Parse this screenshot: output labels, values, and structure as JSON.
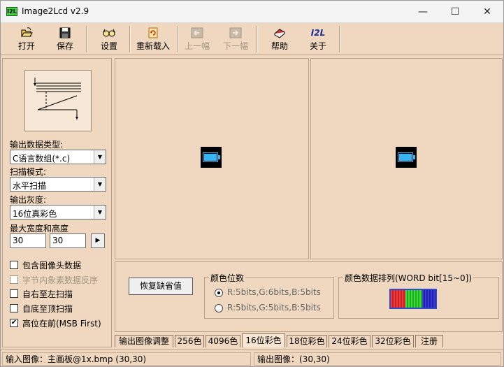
{
  "window": {
    "title": "Image2Lcd v2.9",
    "icon_text": "I2L",
    "min_glyph": "—",
    "max_glyph": "☐",
    "close_glyph": "✕"
  },
  "toolbar": {
    "items": [
      {
        "label": "打开",
        "icon": "folder-open-icon",
        "enabled": true
      },
      {
        "label": "保存",
        "icon": "floppy-disk-icon",
        "enabled": true
      },
      {
        "label": "设置",
        "icon": "glasses-icon",
        "enabled": true
      },
      {
        "label": "重新载入",
        "icon": "reload-icon",
        "enabled": true
      },
      {
        "label": "上一幅",
        "icon": "arrow-left-icon",
        "enabled": false
      },
      {
        "label": "下一幅",
        "icon": "arrow-right-icon",
        "enabled": false
      },
      {
        "label": "帮助",
        "icon": "help-book-icon",
        "enabled": true
      },
      {
        "label": "关于",
        "icon": "i2l-logo-icon",
        "enabled": true
      }
    ],
    "about_icon_text": "I2L"
  },
  "left": {
    "output_type_label": "输出数据类型:",
    "output_type_value": "C语言数组(*.c)",
    "scan_mode_label": "扫描模式:",
    "scan_mode_value": "水平扫描",
    "gray_label": "输出灰度:",
    "gray_value": "16位真彩色",
    "max_size_label": "最大宽度和高度",
    "max_width": "30",
    "max_height": "30",
    "apply_glyph": "▶",
    "dropdown_glyph": "▼",
    "checkboxes": [
      {
        "label": "包含图像头数据",
        "checked": false,
        "enabled": true
      },
      {
        "label": "字节内象素数据反序",
        "checked": false,
        "enabled": false
      },
      {
        "label": "自右至左扫描",
        "checked": false,
        "enabled": true
      },
      {
        "label": "自底至顶扫描",
        "checked": false,
        "enabled": true
      },
      {
        "label": "高位在前(MSB First)",
        "checked": true,
        "enabled": true
      }
    ],
    "check_glyph": "✔"
  },
  "settings": {
    "restore_label": "恢复缺省值",
    "color_bits_title": "颜色位数",
    "options": [
      {
        "label": "R:5bits,G:6bits,B:5bits",
        "selected": true
      },
      {
        "label": "R:5bits,G:5bits,B:5bits",
        "selected": false
      }
    ],
    "order_title": "颜色数据排列(WORD bit[15~0])",
    "bit_colors": {
      "red": "#ef3b3b",
      "green": "#3cdc3c",
      "blue": "#3c3cdc"
    }
  },
  "tabs": [
    {
      "label": "输出图像调整",
      "active": false
    },
    {
      "label": "256色",
      "active": false
    },
    {
      "label": "4096色",
      "active": false
    },
    {
      "label": "16位彩色",
      "active": true
    },
    {
      "label": "18位彩色",
      "active": false
    },
    {
      "label": "24位彩色",
      "active": false
    },
    {
      "label": "32位彩色",
      "active": false
    },
    {
      "label": "注册",
      "active": false
    }
  ],
  "status": {
    "input": "输入图像：主画板@1x.bmp (30,30)",
    "output": "输出图像：(30,30)"
  },
  "colors": {
    "background": "#efd8bf",
    "battery_fill": "#38b4f0",
    "battery_frame": "#000000"
  }
}
